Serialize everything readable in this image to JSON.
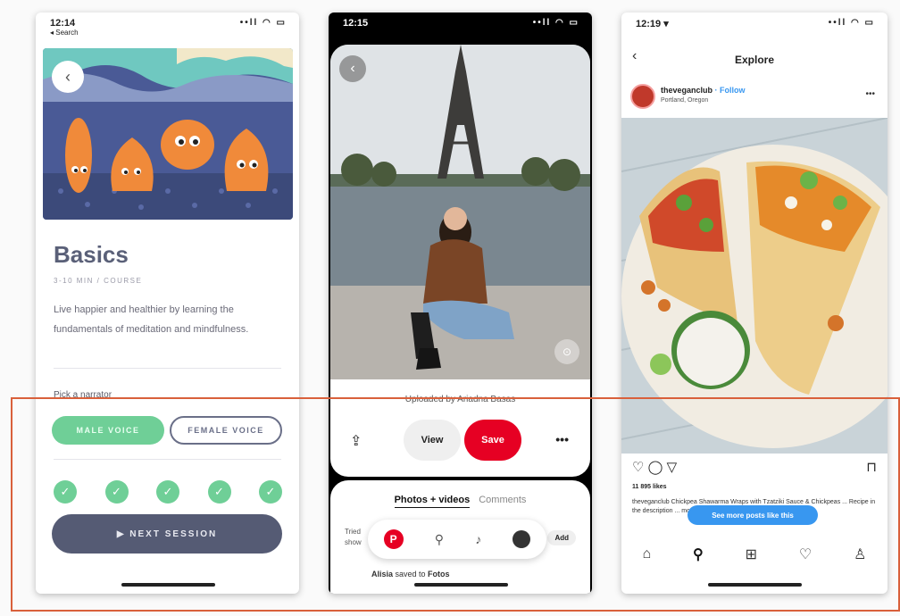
{
  "phone1": {
    "status": {
      "time": "12:14",
      "back_app": "◂ Search",
      "icons": "••ll ◠ ▭"
    },
    "back_icon": "‹",
    "title": "Basics",
    "meta": "3-10 MIN / COURSE",
    "description": "Live happier and healthier by learning the fundamentals of meditation and mindfulness.",
    "narrator_label": "Pick a narrator",
    "male_voice": "MALE VOICE",
    "female_voice": "FEMALE VOICE",
    "checks": [
      "✓",
      "✓",
      "✓",
      "✓",
      "✓"
    ],
    "next_session": "▶  NEXT SESSION",
    "colors": {
      "green": "#6fcf97",
      "slate": "#555b74"
    }
  },
  "phone2": {
    "status": {
      "time": "12:15",
      "icons": "••ll ◠ ▭"
    },
    "back_icon": "‹",
    "lens_icon": "⊙",
    "uploaded_by": "Uploaded by Ariadna Basas",
    "share_icon": "⇪",
    "view": "View",
    "save": "Save",
    "more_icon": "•••",
    "tabs": {
      "active": "Photos + videos",
      "inactive": "Comments"
    },
    "tried_text": "Tried",
    "tried_text2": "show",
    "tried_btn": "Add",
    "nav": {
      "pin": "P",
      "search": "⚲",
      "bell": "♪"
    },
    "saved_user": "Alisia",
    "saved_mid": " saved to ",
    "saved_board": "Fotos",
    "colors": {
      "red": "#e60023"
    }
  },
  "phone3": {
    "status": {
      "time": "12:19 ▾",
      "icons": "••ll ◠ ▭"
    },
    "back_icon": "‹",
    "title": "Explore",
    "username": "theveganclub",
    "follow": " · Follow",
    "location": "Portland, Oregon",
    "more_icon": "•••",
    "actions": "♡  ◯  ▽",
    "bookmark_icon": "⊓",
    "likes": "11 895 likes",
    "caption": "theveganclub Chickpea Shawarma Wraps with Tzatziki Sauce & Chickpeas ... Recipe in the description ... more",
    "more_posts": "See more posts like this",
    "nav": [
      "⌂",
      "⚲",
      "⊞",
      "♡",
      "♙"
    ],
    "colors": {
      "blue": "#3897f0"
    }
  }
}
